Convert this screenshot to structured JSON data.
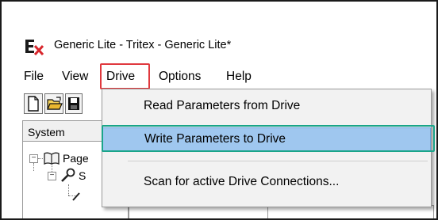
{
  "window": {
    "title": "Generic Lite - Tritex - Generic Lite*",
    "app_icon": "ex-logo-icon"
  },
  "menubar": {
    "items": [
      {
        "label": "File"
      },
      {
        "label": "View"
      },
      {
        "label": "Drive"
      },
      {
        "label": "Options"
      },
      {
        "label": "Help"
      }
    ]
  },
  "toolbar": {
    "buttons": [
      {
        "icon": "new-document-icon"
      },
      {
        "icon": "open-folder-icon"
      },
      {
        "icon": "save-disk-icon"
      }
    ]
  },
  "panel": {
    "header": "System",
    "tree": [
      {
        "label": "Page",
        "icon": "book-icon",
        "expander": "minus"
      },
      {
        "label": "S",
        "icon": "tools-icon",
        "expander": "minus"
      }
    ]
  },
  "drive_menu": {
    "items": [
      {
        "label": "Read Parameters from Drive"
      },
      {
        "label": "Write Parameters to Drive"
      },
      {
        "label": "Scan for active Drive Connections..."
      }
    ]
  },
  "annotations": {
    "drive_highlight_color": "#e0393e",
    "write_highlight_color": "#1aa58a",
    "selected_item_color": "#9fc7ef"
  }
}
